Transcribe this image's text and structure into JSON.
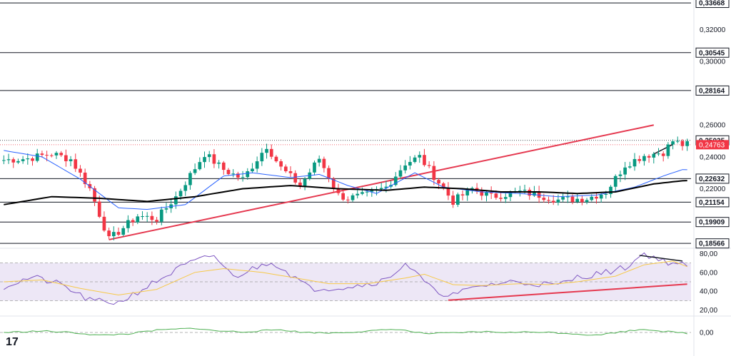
{
  "colors": {
    "up": "#089981",
    "down": "#f23645",
    "level_line": "#131722",
    "trendline": "#e5384f",
    "ema_short": "#2962ff",
    "ema_long": "#000000",
    "rsi_line": "#7e57c2",
    "rsi_ma": "#f7c948",
    "rsi_band": "#ede7f6",
    "osc_line": "#4caf50",
    "price_tag": "#f23645"
  },
  "logo": {
    "text": "17",
    "icon": "tradingview-logo-icon"
  },
  "chart_data": [
    {
      "type": "candlestick",
      "pane": "price",
      "ylim": [
        0.1835,
        0.3385
      ],
      "y_ticks": [
        "0,32000",
        "0,30000",
        "0,26000",
        "0,24000",
        "0,22000"
      ],
      "levels": [
        {
          "value": 0.33668,
          "label": "0,33668",
          "style": "solid"
        },
        {
          "value": 0.30545,
          "label": "0,30545",
          "style": "solid"
        },
        {
          "value": 0.28164,
          "label": "0,28164",
          "style": "solid"
        },
        {
          "value": 0.25035,
          "label": "0,25035",
          "style": "dotted"
        },
        {
          "value": 0.22632,
          "label": "0,22632",
          "style": "solid"
        },
        {
          "value": 0.21154,
          "label": "0,21154",
          "style": "solid"
        },
        {
          "value": 0.19909,
          "label": "0,19909",
          "style": "solid"
        },
        {
          "value": 0.18566,
          "label": "0,18566",
          "style": "solid"
        }
      ],
      "current_price": {
        "value": 0.24763,
        "label": "0,24763"
      },
      "trendlines": [
        {
          "from": [
            22,
            0.188
          ],
          "to": [
            136,
            0.26
          ],
          "color": "trendline"
        },
        {
          "from": [
            136,
            0.2418
          ],
          "to": [
            140,
            0.2478
          ],
          "color": "level_line"
        }
      ],
      "anchors": [
        [
          0,
          0.238
        ],
        [
          5,
          0.239
        ],
        [
          10,
          0.242
        ],
        [
          14,
          0.2385
        ],
        [
          18,
          0.22
        ],
        [
          22,
          0.188
        ],
        [
          28,
          0.203
        ],
        [
          32,
          0.201
        ],
        [
          36,
          0.215
        ],
        [
          42,
          0.242
        ],
        [
          46,
          0.232
        ],
        [
          50,
          0.226
        ],
        [
          55,
          0.247
        ],
        [
          58,
          0.233
        ],
        [
          62,
          0.222
        ],
        [
          66,
          0.239
        ],
        [
          70,
          0.216
        ],
        [
          72,
          0.214
        ],
        [
          76,
          0.216
        ],
        [
          80,
          0.221
        ],
        [
          84,
          0.236
        ],
        [
          87,
          0.24
        ],
        [
          90,
          0.228
        ],
        [
          94,
          0.212
        ],
        [
          98,
          0.22
        ],
        [
          102,
          0.215
        ],
        [
          108,
          0.218
        ],
        [
          112,
          0.216
        ],
        [
          116,
          0.213
        ],
        [
          122,
          0.214
        ],
        [
          126,
          0.218
        ],
        [
          130,
          0.235
        ],
        [
          134,
          0.241
        ],
        [
          138,
          0.243
        ],
        [
          140,
          0.25
        ],
        [
          142,
          0.2476
        ]
      ],
      "ema_short_anchors": [
        [
          0,
          0.244
        ],
        [
          8,
          0.24
        ],
        [
          16,
          0.226
        ],
        [
          24,
          0.208
        ],
        [
          30,
          0.207
        ],
        [
          38,
          0.21
        ],
        [
          46,
          0.228
        ],
        [
          52,
          0.23
        ],
        [
          60,
          0.227
        ],
        [
          66,
          0.229
        ],
        [
          72,
          0.222
        ],
        [
          78,
          0.217
        ],
        [
          86,
          0.23
        ],
        [
          92,
          0.221
        ],
        [
          100,
          0.218
        ],
        [
          108,
          0.217
        ],
        [
          116,
          0.215
        ],
        [
          124,
          0.216
        ],
        [
          132,
          0.221
        ],
        [
          138,
          0.228
        ],
        [
          142,
          0.232
        ]
      ],
      "ema_long_anchors": [
        [
          0,
          0.21
        ],
        [
          10,
          0.215
        ],
        [
          20,
          0.214
        ],
        [
          30,
          0.212
        ],
        [
          40,
          0.215
        ],
        [
          50,
          0.22
        ],
        [
          60,
          0.222
        ],
        [
          70,
          0.22
        ],
        [
          80,
          0.219
        ],
        [
          88,
          0.221
        ],
        [
          96,
          0.22
        ],
        [
          104,
          0.218
        ],
        [
          112,
          0.218
        ],
        [
          120,
          0.217
        ],
        [
          128,
          0.218
        ],
        [
          136,
          0.223
        ],
        [
          142,
          0.225
        ]
      ]
    },
    {
      "type": "line",
      "pane": "rsi",
      "ylim": [
        16,
        84
      ],
      "y_ticks": [
        "80,00",
        "60,00",
        "40,00",
        "20,00"
      ],
      "band": [
        30,
        70
      ],
      "midline": 50,
      "trendlines": [
        {
          "from": [
            93,
            30.5
          ],
          "to": [
            143,
            47.5
          ],
          "color": "trendline"
        },
        {
          "from": [
            133,
            78
          ],
          "to": [
            142,
            72
          ],
          "color": "level_line"
        }
      ],
      "anchors": [
        [
          0,
          45
        ],
        [
          6,
          55
        ],
        [
          12,
          47
        ],
        [
          18,
          30
        ],
        [
          24,
          28
        ],
        [
          30,
          45
        ],
        [
          38,
          68
        ],
        [
          44,
          78
        ],
        [
          48,
          55
        ],
        [
          56,
          72
        ],
        [
          60,
          58
        ],
        [
          64,
          43
        ],
        [
          70,
          44
        ],
        [
          74,
          46
        ],
        [
          80,
          52
        ],
        [
          84,
          70
        ],
        [
          90,
          40
        ],
        [
          94,
          36
        ],
        [
          100,
          46
        ],
        [
          106,
          50
        ],
        [
          112,
          48
        ],
        [
          116,
          46
        ],
        [
          120,
          55
        ],
        [
          126,
          60
        ],
        [
          130,
          65
        ],
        [
          134,
          80
        ],
        [
          138,
          72
        ],
        [
          142,
          68
        ],
        [
          143,
          64
        ]
      ],
      "ma_anchors": [
        [
          0,
          50
        ],
        [
          8,
          52
        ],
        [
          16,
          43
        ],
        [
          24,
          36
        ],
        [
          32,
          42
        ],
        [
          40,
          60
        ],
        [
          46,
          64
        ],
        [
          54,
          60
        ],
        [
          60,
          55
        ],
        [
          68,
          48
        ],
        [
          76,
          48
        ],
        [
          84,
          54
        ],
        [
          88,
          58
        ],
        [
          94,
          47
        ],
        [
          100,
          46
        ],
        [
          108,
          48
        ],
        [
          114,
          47
        ],
        [
          120,
          50
        ],
        [
          128,
          56
        ],
        [
          134,
          68
        ],
        [
          140,
          72
        ],
        [
          143,
          66
        ]
      ]
    },
    {
      "type": "line",
      "pane": "oscillator",
      "ylim": [
        -0.05,
        0.05
      ],
      "y_ticks": [
        "0,00"
      ],
      "zero_line": 0,
      "anchors": [
        [
          0,
          0.0
        ],
        [
          8,
          0.005
        ],
        [
          14,
          0.0
        ],
        [
          20,
          -0.01
        ],
        [
          26,
          -0.005
        ],
        [
          32,
          0.008
        ],
        [
          40,
          0.015
        ],
        [
          44,
          0.006
        ],
        [
          50,
          0.002
        ],
        [
          58,
          0.01
        ],
        [
          62,
          0.001
        ],
        [
          68,
          -0.002
        ],
        [
          76,
          0.004
        ],
        [
          82,
          0.012
        ],
        [
          88,
          -0.004
        ],
        [
          94,
          -0.002
        ],
        [
          100,
          0.003
        ],
        [
          106,
          0.0
        ],
        [
          112,
          0.002
        ],
        [
          118,
          -0.003
        ],
        [
          124,
          -0.01
        ],
        [
          128,
          0.0
        ],
        [
          134,
          0.012
        ],
        [
          138,
          0.004
        ],
        [
          143,
          -0.003
        ]
      ]
    }
  ]
}
